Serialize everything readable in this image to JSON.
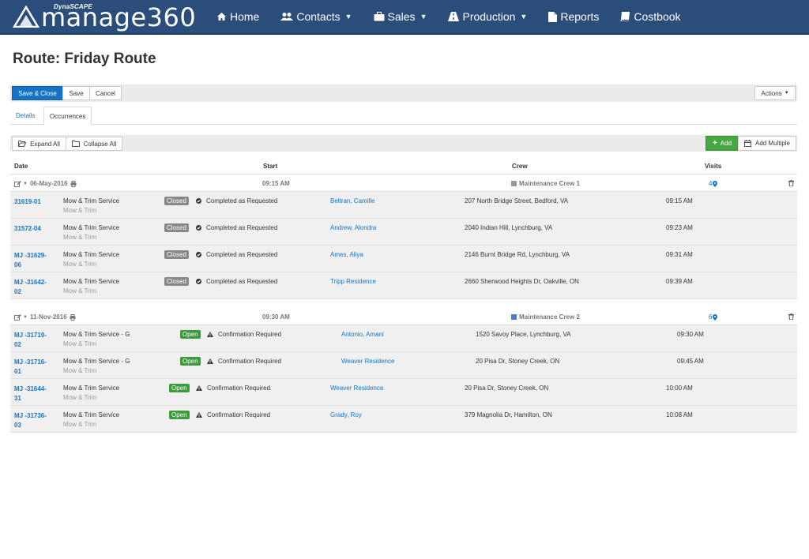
{
  "brand": {
    "small": "DynaSCAPE",
    "main": "manage360"
  },
  "nav": [
    {
      "label": "Home",
      "icon": "home-icon",
      "dropdown": false
    },
    {
      "label": "Contacts",
      "icon": "users-icon",
      "dropdown": true
    },
    {
      "label": "Sales",
      "icon": "briefcase-icon",
      "dropdown": true
    },
    {
      "label": "Production",
      "icon": "road-icon",
      "dropdown": true
    },
    {
      "label": "Reports",
      "icon": "file-icon",
      "dropdown": false
    },
    {
      "label": "Costbook",
      "icon": "book-icon",
      "dropdown": false
    }
  ],
  "page": {
    "title": "Route: Friday Route"
  },
  "toolbar": {
    "save_close": "Save & Close",
    "save": "Save",
    "cancel": "Cancel",
    "actions": "Actions"
  },
  "tabs": {
    "details": "Details",
    "occurrences": "Occurrences"
  },
  "occ_toolbar": {
    "expand": "Expand All",
    "collapse": "Collapse All",
    "add": "Add",
    "add_multiple": "Add Multiple"
  },
  "columns": {
    "date": "Date",
    "start": "Start",
    "crew": "Crew",
    "visits": "Visits"
  },
  "groups": [
    {
      "date": "06-May-2016",
      "start": "09:15 AM",
      "crew": "Maintenance Crew 1",
      "crew_color": "#9a9a9a",
      "visits": "4",
      "rows": [
        {
          "id1": "31619-01",
          "id2": "",
          "service": "Mow & Trim Service",
          "sub": "Mow & Trim",
          "badge": "Closed",
          "status": "Completed as Requested",
          "client": "Beltran, Camille",
          "address": "207 North Bridge Street, Bedford, VA",
          "time": "09:15 AM"
        },
        {
          "id1": "31572-04",
          "id2": "",
          "service": "Mow & Trim Service",
          "sub": "Mow & Trim",
          "badge": "Closed",
          "status": "Completed as Requested",
          "client": "Andrew, Alondra",
          "address": "2040 Indian Hill, Lynchburg, VA",
          "time": "09:23 AM"
        },
        {
          "id1": "MJ -31629-",
          "id2": "06",
          "service": "Mow & Trim Service",
          "sub": "Mow & Trim",
          "badge": "Closed",
          "status": "Completed as Requested",
          "client": "Ames, Aliya",
          "address": "2146 Burnt Bridge Rd, Lynchburg, VA",
          "time": "09:31 AM"
        },
        {
          "id1": "MJ -31642-",
          "id2": "02",
          "service": "Mow & Trim Service",
          "sub": "Mow & Trim",
          "badge": "Closed",
          "status": "Completed as Requested",
          "client": "Tripp Residence",
          "address": "2660 Sherwood Heights Dr, Oakville, ON",
          "time": "09:39 AM"
        }
      ]
    },
    {
      "date": "11-Nov-2016",
      "start": "09:30 AM",
      "crew": "Maintenance Crew 2",
      "crew_color": "#4a7fd0",
      "visits": "6",
      "rows": [
        {
          "id1": "MJ -31719-",
          "id2": "02",
          "service": "Mow & Trim Service - G",
          "sub": "Mow & Trim",
          "badge": "Open",
          "status": "Confirmation Required",
          "client": "Antonio, Amani",
          "address": "1520 Savoy Place, Lynchburg, VA",
          "time": "09:30 AM"
        },
        {
          "id1": "MJ -31716-",
          "id2": "01",
          "service": "Mow & Trim Service - G",
          "sub": "Mow & Trim",
          "badge": "Open",
          "status": "Confirmation Required",
          "client": "Weaver Residence",
          "address": "20 Pisa Dr, Stoney Creek, ON",
          "time": "09:45 AM"
        },
        {
          "id1": "MJ -31644-",
          "id2": "31",
          "service": "Mow & Trim Service",
          "sub": "Mow & Trim",
          "badge": "Open",
          "status": "Confirmation Required",
          "client": "Weaver Residence",
          "address": "20 Pisa Dr, Stoney Creek, ON",
          "time": "10:00 AM"
        },
        {
          "id1": "MJ -31736-",
          "id2": "03",
          "service": "Mow & Trim Service",
          "sub": "Mow & Trim",
          "badge": "Open",
          "status": "Confirmation Required",
          "client": "Grady, Roy",
          "address": "379 Magnolia Dr, Hamilton, ON",
          "time": "10:08 AM"
        }
      ]
    }
  ]
}
